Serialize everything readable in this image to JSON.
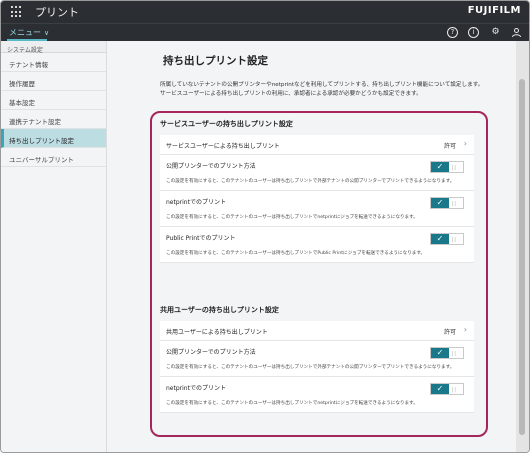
{
  "header": {
    "app_title": "プリント",
    "brand_main": "FUJIFILM",
    "menu_label": "メニュー",
    "icons": [
      "help-icon",
      "info-icon",
      "gear-icon",
      "user-icon"
    ]
  },
  "sidebar": {
    "heading": "システム設定",
    "items": [
      {
        "label": "テナント情報"
      },
      {
        "label": "操作履歴"
      },
      {
        "label": "基本設定"
      },
      {
        "label": "連携テナント設定"
      },
      {
        "label": "持ち出しプリント設定"
      },
      {
        "label": "ユニバーサルプリント"
      }
    ]
  },
  "main": {
    "title": "持ち出しプリント設定",
    "description_line1": "所属していないテナントの公開プリンターやnetprintなどを利用してプリントする、持ち出しプリント機能について設定します。",
    "description_line2": "サービスユーザーによる持ち出しプリントの利用に、承認者による承認が必要かどうかも設定できます。",
    "sections": [
      {
        "title": "サービスユーザーの持ち出しプリント設定",
        "link_row": {
          "label": "サービスユーザーによる持ち出しプリント",
          "value": "許可"
        },
        "toggles": [
          {
            "label": "公開プリンターでのプリント方法",
            "sub": "この設定を有効にすると、このテナントのユーザーは持ち出しプリントで外部テナントの公開プリンターでプリントできるようになります。",
            "checked": true
          },
          {
            "label": "netprintでのプリント",
            "sub": "この設定を有効にすると、このテナントのユーザーは持ち出しプリントでnetprintにジョブを転送できるようになります。",
            "checked": true
          },
          {
            "label": "Public Printでのプリント",
            "sub": "この設定を有効にすると、このテナントのユーザーは持ち出しプリントでPublic Printにジョブを転送できるようになります。",
            "checked": true
          }
        ]
      },
      {
        "title": "共用ユーザーの持ち出しプリント設定",
        "link_row": {
          "label": "共用ユーザーによる持ち出しプリント",
          "value": "許可"
        },
        "toggles": [
          {
            "label": "公開プリンターでのプリント方法",
            "sub": "この設定を有効にすると、このテナントのユーザーは持ち出しプリントで外部テナントの公開プリンターでプリントできるようになります。",
            "checked": true
          },
          {
            "label": "netprintでのプリント",
            "sub": "この設定を有効にすると、このテナントのユーザーは持ち出しプリントでnetprintにジョブを転送できるようになります。",
            "checked": true
          }
        ]
      }
    ]
  },
  "colors": {
    "header_bg": "#2b2f33",
    "accent": "#19788a",
    "highlight_outline": "#a3275a",
    "active_sidebar": "#bcdde2"
  }
}
